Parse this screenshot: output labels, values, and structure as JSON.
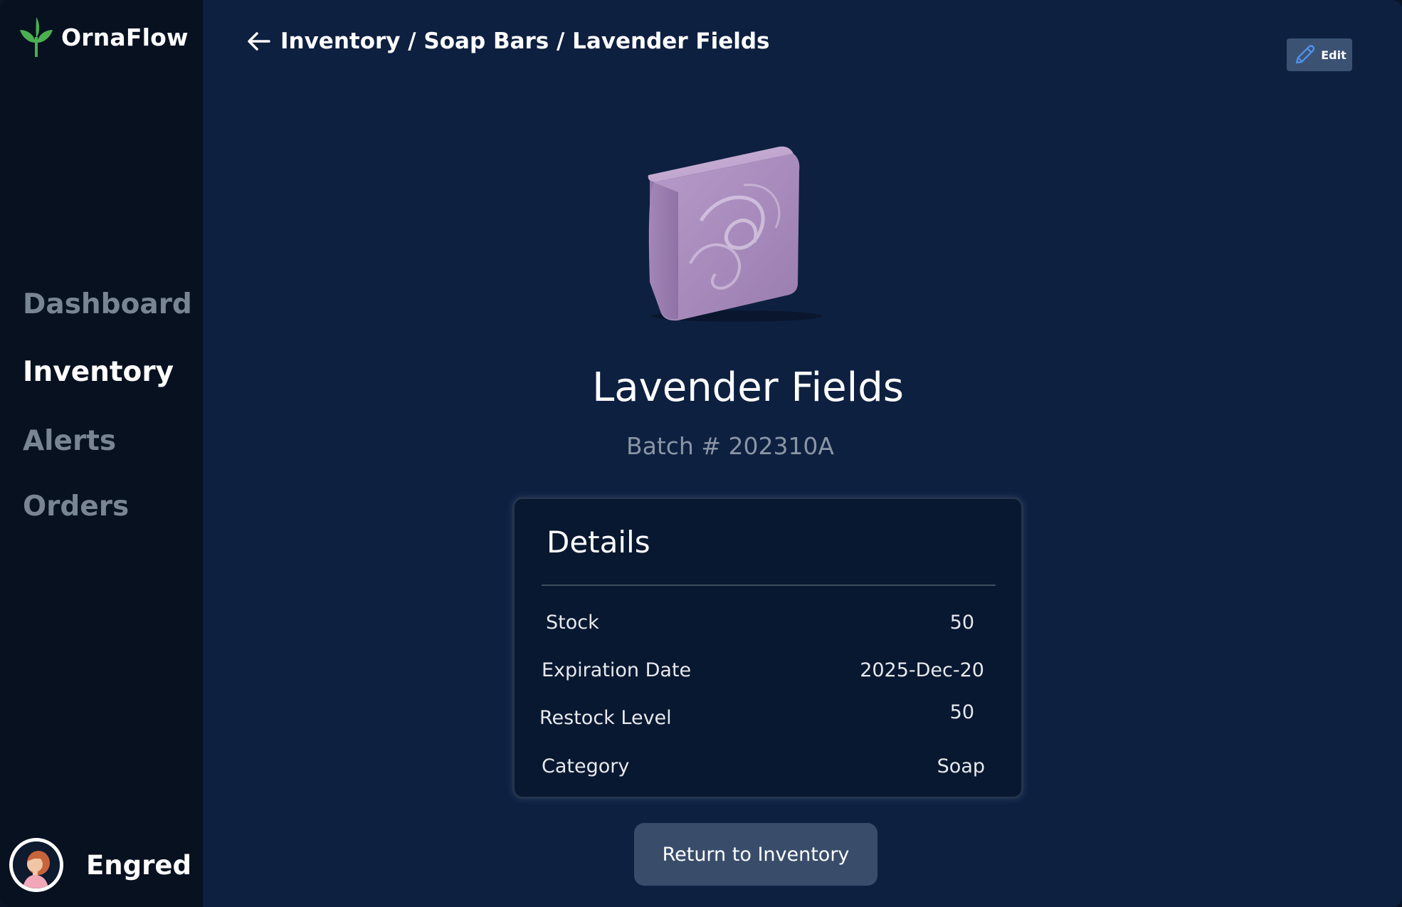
{
  "app": {
    "name": "OrnaFlow",
    "accent_color": "#4caf50"
  },
  "sidebar": {
    "items": [
      {
        "label": "Dashboard",
        "active": false
      },
      {
        "label": "Inventory",
        "active": true
      },
      {
        "label": "Alerts",
        "active": false
      },
      {
        "label": "Orders",
        "active": false
      }
    ],
    "user": {
      "name": "Engred",
      "icon": "user-avatar"
    }
  },
  "header": {
    "back_icon": "arrow-left-icon",
    "breadcrumb": "Inventory / Soap Bars / Lavender Fields",
    "edit_label": "Edit",
    "edit_icon": "pencil-icon"
  },
  "product": {
    "name": "Lavender Fields",
    "batch": "Batch # 202310A",
    "image": "lavender-soap-bar"
  },
  "details": {
    "title": "Details",
    "rows": [
      {
        "label": "Stock",
        "value": "50"
      },
      {
        "label": "Expiration Date",
        "value": "2025-Dec-20"
      },
      {
        "label": "Restock Level",
        "value": "50"
      },
      {
        "label": "Category",
        "value": "Soap"
      }
    ]
  },
  "actions": {
    "return_label": "Return to Inventory"
  }
}
